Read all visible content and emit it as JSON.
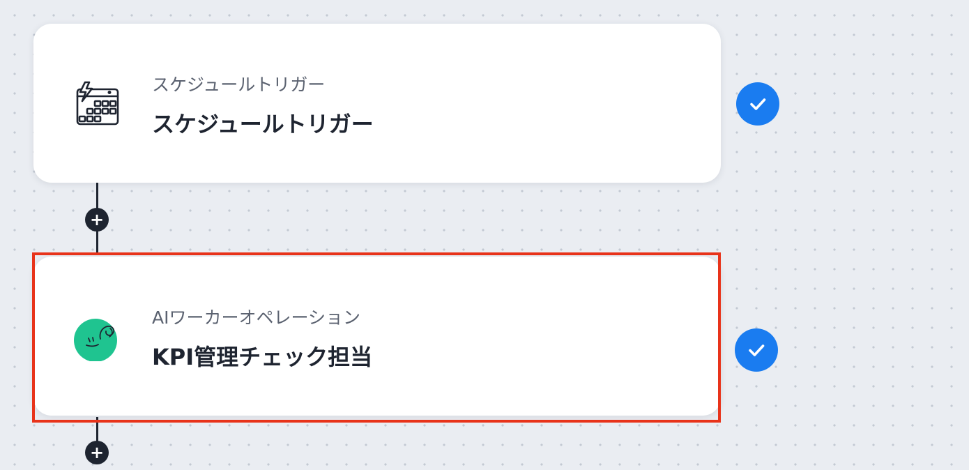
{
  "flow": {
    "steps": [
      {
        "subtitle": "スケジュールトリガー",
        "title": "スケジュールトリガー",
        "icon": "schedule-trigger-calendar-icon",
        "status": "completed",
        "status_icon": "checkmark-icon"
      },
      {
        "subtitle": "AIワーカーオペレーション",
        "title": "KPI管理チェック担当",
        "icon": "ai-worker-avatar-icon",
        "status": "completed",
        "status_icon": "checkmark-icon",
        "highlighted": true
      }
    ],
    "add_step_icon": "+",
    "colors": {
      "canvas": "#eaedf2",
      "accent_check": "#1a7cf0",
      "highlight_border": "#e8331a",
      "ai_avatar": "#1fc490",
      "connector": "#1e2430"
    }
  }
}
